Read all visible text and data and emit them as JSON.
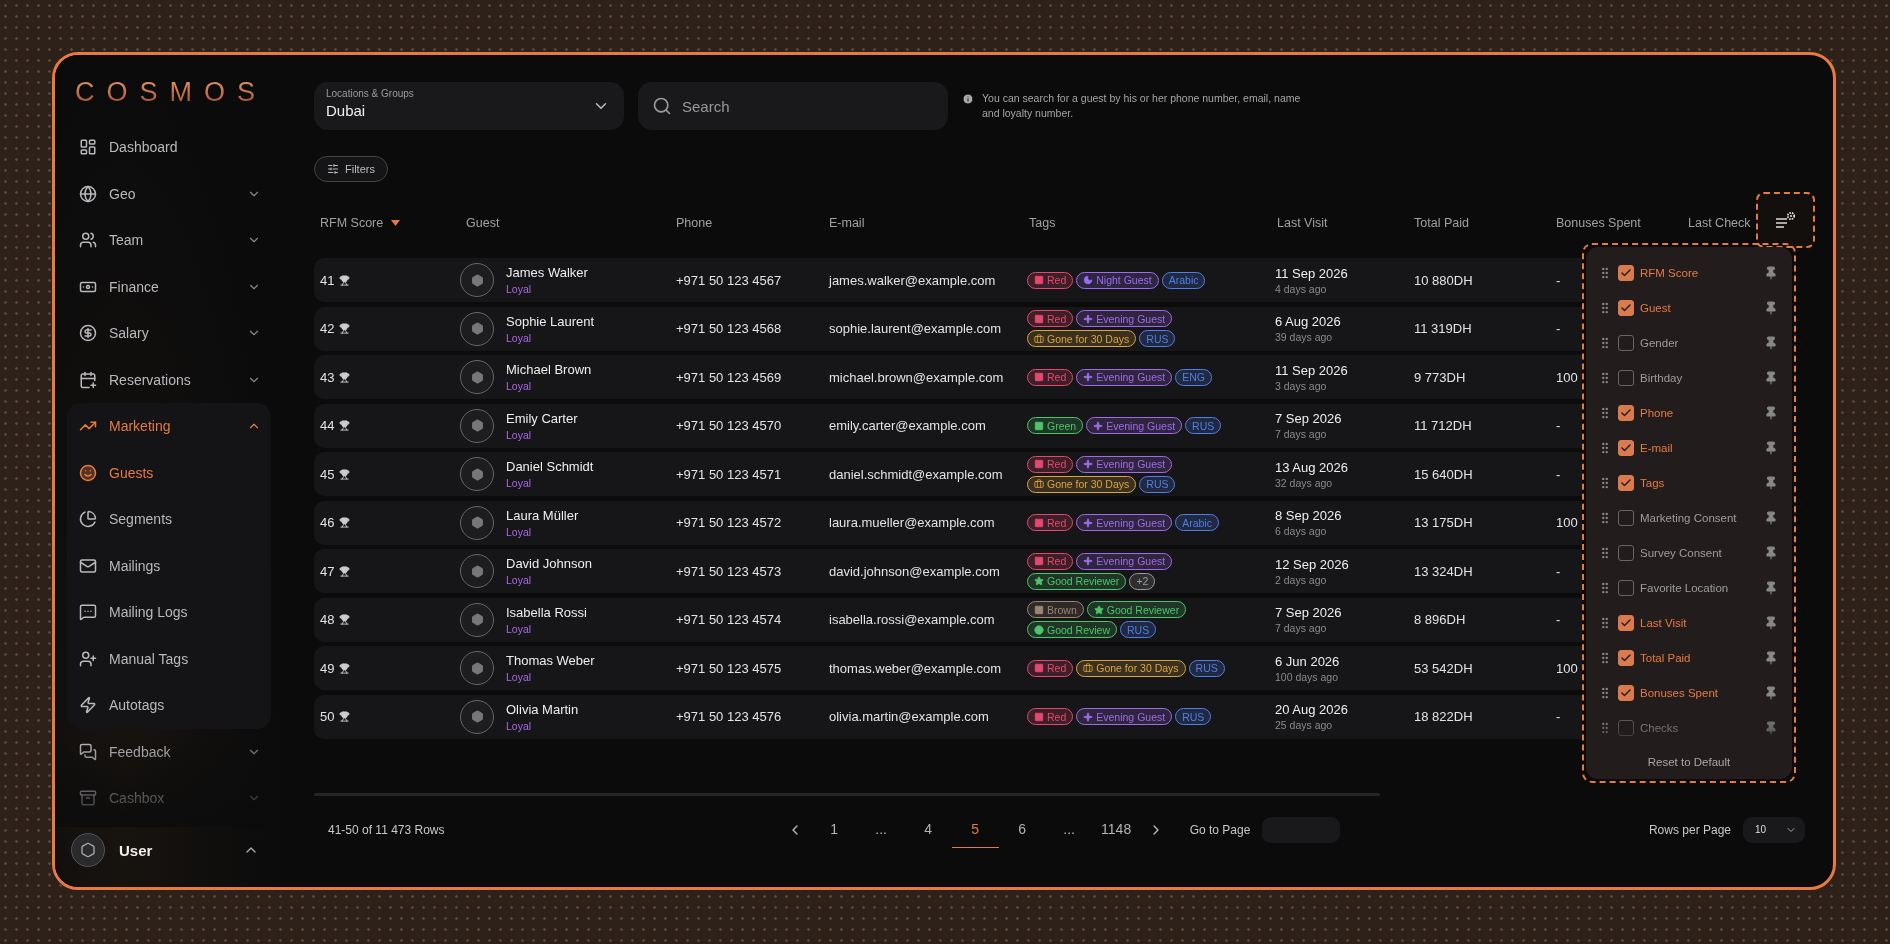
{
  "logo": "COSMOS",
  "nav": [
    {
      "label": "Dashboard",
      "selected": false
    },
    {
      "label": "Geo",
      "selected": false,
      "expanded": false
    },
    {
      "label": "Team",
      "selected": false,
      "expanded": false
    },
    {
      "label": "Finance",
      "selected": false,
      "expanded": false
    },
    {
      "label": "Salary",
      "selected": false,
      "expanded": false
    },
    {
      "label": "Reservations",
      "selected": false,
      "expanded": false
    },
    {
      "label": "Marketing",
      "selected": true,
      "expanded": true,
      "children": [
        {
          "label": "Guests",
          "selected": true
        },
        {
          "label": "Segments",
          "selected": false
        },
        {
          "label": "Mailings",
          "selected": false
        },
        {
          "label": "Mailing Logs",
          "selected": false
        },
        {
          "label": "Manual Tags",
          "selected": false
        },
        {
          "label": "Autotags",
          "selected": false
        }
      ]
    },
    {
      "label": "Feedback",
      "selected": false,
      "expanded": false
    },
    {
      "label": "Cashbox",
      "selected": false,
      "expanded": false
    }
  ],
  "user": {
    "name": "User",
    "expanded": true
  },
  "location": {
    "label": "Locations & Groups",
    "value": "Dubai"
  },
  "search": {
    "placeholder": "Search",
    "hint": "You can search for a guest by his or her phone number, email, name and loyalty number."
  },
  "filters_button": "Filters",
  "table": {
    "columns": [
      {
        "label": "RFM Score",
        "sorted": true
      },
      {
        "label": "Guest",
        "sorted": false
      },
      {
        "label": "Phone",
        "sorted": false
      },
      {
        "label": "E-mail",
        "sorted": false
      },
      {
        "label": "Tags",
        "sorted": false
      },
      {
        "label": "Last Visit",
        "sorted": false
      },
      {
        "label": "Total Paid",
        "sorted": false
      },
      {
        "label": "Bonuses Spent",
        "sorted": false
      },
      {
        "label": "Last Check",
        "sorted": false
      }
    ],
    "rows": [
      {
        "score": "41",
        "name": "James Walker",
        "status": "Loyal",
        "phone": "+971 50 123 4567",
        "email": "james.walker@example.com",
        "tags": [
          {
            "label": "Red",
            "kind": "label",
            "color": "#e5486e"
          },
          {
            "label": "Night Guest",
            "kind": "night",
            "color": "#9b6cf0"
          },
          {
            "label": "Arabic",
            "kind": "language",
            "color": "#4f7fe8"
          }
        ],
        "last_visit": "11 Sep 2026",
        "ago": "4 days ago",
        "total_paid": "10 880DH",
        "bonuses": "-"
      },
      {
        "score": "42",
        "name": "Sophie Laurent",
        "status": "Loyal",
        "phone": "+971 50 123 4568",
        "email": "sophie.laurent@example.com",
        "tags": [
          {
            "label": "Red",
            "kind": "label",
            "color": "#e5486e"
          },
          {
            "label": "Evening Guest",
            "kind": "evening",
            "color": "#a06ae8"
          },
          {
            "label": "Gone for 30 Days",
            "kind": "absence",
            "color": "#d9a441"
          },
          {
            "label": "RUS",
            "kind": "language",
            "color": "#4f7fe8"
          }
        ],
        "last_visit": "6 Aug 2026",
        "ago": "39 days ago",
        "total_paid": "11 319DH",
        "bonuses": "-"
      },
      {
        "score": "43",
        "name": "Michael Brown",
        "status": "Loyal",
        "phone": "+971 50 123 4569",
        "email": "michael.brown@example.com",
        "tags": [
          {
            "label": "Red",
            "kind": "label",
            "color": "#e5486e"
          },
          {
            "label": "Evening Guest",
            "kind": "evening",
            "color": "#a06ae8"
          },
          {
            "label": "ENG",
            "kind": "language",
            "color": "#4f7fe8"
          }
        ],
        "last_visit": "11 Sep 2026",
        "ago": "3 days ago",
        "total_paid": "9 773DH",
        "bonuses": "100"
      },
      {
        "score": "44",
        "name": "Emily Carter",
        "status": "Loyal",
        "phone": "+971 50 123 4570",
        "email": "emily.carter@example.com",
        "tags": [
          {
            "label": "Green",
            "kind": "label",
            "color": "#4cc46a"
          },
          {
            "label": "Evening Guest",
            "kind": "evening",
            "color": "#a06ae8"
          },
          {
            "label": "RUS",
            "kind": "language",
            "color": "#4f7fe8"
          }
        ],
        "last_visit": "7 Sep 2026",
        "ago": "7 days ago",
        "total_paid": "11 712DH",
        "bonuses": "-"
      },
      {
        "score": "45",
        "name": "Daniel Schmidt",
        "status": "Loyal",
        "phone": "+971 50 123 4571",
        "email": "daniel.schmidt@example.com",
        "tags": [
          {
            "label": "Red",
            "kind": "label",
            "color": "#e5486e"
          },
          {
            "label": "Evening Guest",
            "kind": "evening",
            "color": "#a06ae8"
          },
          {
            "label": "Gone for 30 Days",
            "kind": "absence",
            "color": "#d9a441"
          },
          {
            "label": "RUS",
            "kind": "language",
            "color": "#4f7fe8"
          }
        ],
        "last_visit": "13 Aug 2026",
        "ago": "32 days ago",
        "total_paid": "15 640DH",
        "bonuses": "-"
      },
      {
        "score": "46",
        "name": "Laura Müller",
        "status": "Loyal",
        "phone": "+971 50 123 4572",
        "email": "laura.mueller@example.com",
        "tags": [
          {
            "label": "Red",
            "kind": "label",
            "color": "#e5486e"
          },
          {
            "label": "Evening Guest",
            "kind": "evening",
            "color": "#a06ae8"
          },
          {
            "label": "Arabic",
            "kind": "language",
            "color": "#4f7fe8"
          }
        ],
        "last_visit": "8 Sep 2026",
        "ago": "6 days ago",
        "total_paid": "13 175DH",
        "bonuses": "100"
      },
      {
        "score": "47",
        "name": "David Johnson",
        "status": "Loyal",
        "phone": "+971 50 123 4573",
        "email": "david.johnson@example.com",
        "tags": [
          {
            "label": "Red",
            "kind": "label",
            "color": "#e5486e"
          },
          {
            "label": "Evening Guest",
            "kind": "evening",
            "color": "#a06ae8"
          },
          {
            "label": "Good Reviewer",
            "kind": "reviewer",
            "color": "#4cc46a"
          },
          {
            "label": "+2",
            "kind": "more",
            "color": "#9a9a9a"
          }
        ],
        "last_visit": "12 Sep 2026",
        "ago": "2 days ago",
        "total_paid": "13 324DH",
        "bonuses": "-"
      },
      {
        "score": "48",
        "name": "Isabella Rossi",
        "status": "Loyal",
        "phone": "+971 50 123 4574",
        "email": "isabella.rossi@example.com",
        "tags": [
          {
            "label": "Brown",
            "kind": "label",
            "color": "#9a8672"
          },
          {
            "label": "Good Reviewer",
            "kind": "reviewer",
            "color": "#4cc46a"
          },
          {
            "label": "Good Review",
            "kind": "review",
            "color": "#4cc46a"
          },
          {
            "label": "RUS",
            "kind": "language",
            "color": "#4f7fe8"
          }
        ],
        "last_visit": "7 Sep 2026",
        "ago": "7 days ago",
        "total_paid": "8 896DH",
        "bonuses": "-"
      },
      {
        "score": "49",
        "name": "Thomas Weber",
        "status": "Loyal",
        "phone": "+971 50 123 4575",
        "email": "thomas.weber@example.com",
        "tags": [
          {
            "label": "Red",
            "kind": "label",
            "color": "#e5486e"
          },
          {
            "label": "Gone for 30 Days",
            "kind": "absence",
            "color": "#d9a441"
          },
          {
            "label": "RUS",
            "kind": "language",
            "color": "#4f7fe8"
          }
        ],
        "last_visit": "6 Jun 2026",
        "ago": "100 days ago",
        "total_paid": "53 542DH",
        "bonuses": "100"
      },
      {
        "score": "50",
        "name": "Olivia Martin",
        "status": "Loyal",
        "phone": "+971 50 123 4576",
        "email": "olivia.martin@example.com",
        "tags": [
          {
            "label": "Red",
            "kind": "label",
            "color": "#e5486e"
          },
          {
            "label": "Evening Guest",
            "kind": "evening",
            "color": "#a06ae8"
          },
          {
            "label": "RUS",
            "kind": "language",
            "color": "#4f7fe8"
          }
        ],
        "last_visit": "20 Aug 2026",
        "ago": "25 days ago",
        "total_paid": "18 822DH",
        "bonuses": "-"
      }
    ]
  },
  "column_menu": {
    "items": [
      {
        "label": "RFM Score",
        "checked": true
      },
      {
        "label": "Guest",
        "checked": true
      },
      {
        "label": "Gender",
        "checked": false
      },
      {
        "label": "Birthday",
        "checked": false
      },
      {
        "label": "Phone",
        "checked": true
      },
      {
        "label": "E-mail",
        "checked": true
      },
      {
        "label": "Tags",
        "checked": true
      },
      {
        "label": "Marketing Consent",
        "checked": false
      },
      {
        "label": "Survey Consent",
        "checked": false
      },
      {
        "label": "Favorite Location",
        "checked": false
      },
      {
        "label": "Last Visit",
        "checked": true
      },
      {
        "label": "Total Paid",
        "checked": true
      },
      {
        "label": "Bonuses Spent",
        "checked": true
      },
      {
        "label": "Checks",
        "checked": false
      }
    ],
    "reset": "Reset to Default"
  },
  "footer": {
    "range": "41-50 of 11 473 Rows",
    "pages": [
      {
        "label": "1",
        "selected": false
      },
      {
        "label": "...",
        "selected": false
      },
      {
        "label": "4",
        "selected": false
      },
      {
        "label": "5",
        "selected": true
      },
      {
        "label": "6",
        "selected": false
      },
      {
        "label": "...",
        "selected": false
      },
      {
        "label": "1148",
        "selected": false
      }
    ],
    "go_to_page": "Go to Page",
    "rows_per_page": "Rows per Page",
    "rows_value": "10"
  }
}
